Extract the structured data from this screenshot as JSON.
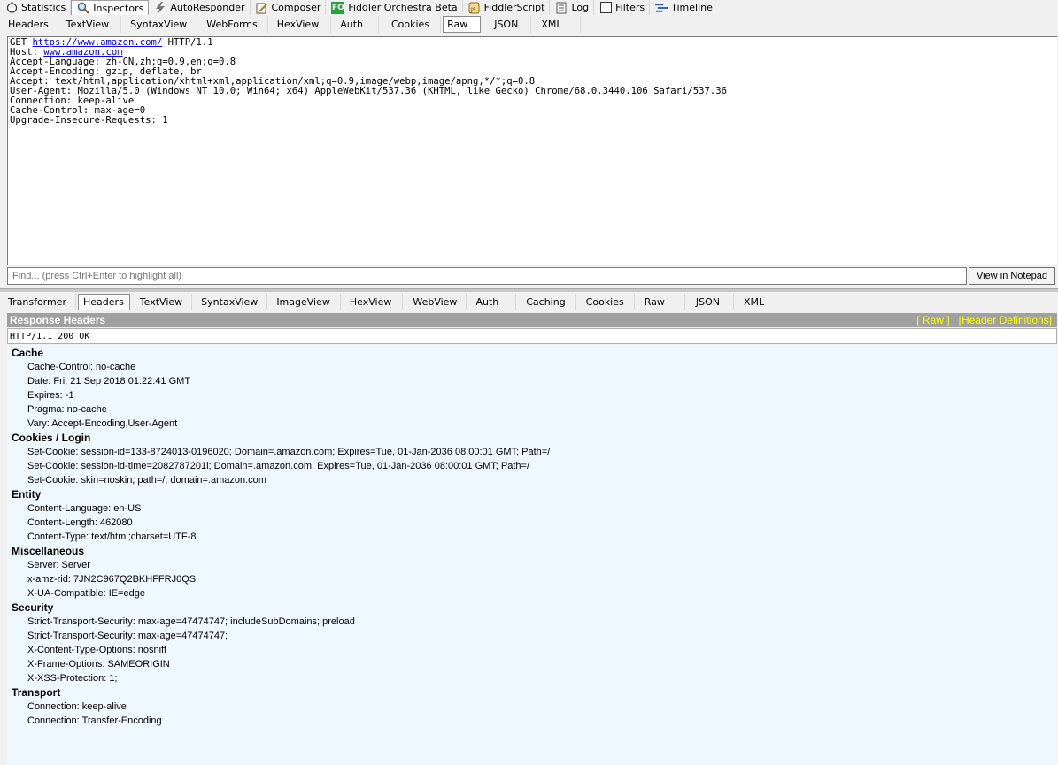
{
  "main_tabs": [
    {
      "label": "Statistics",
      "icon": "stopwatch-icon"
    },
    {
      "label": "Inspectors",
      "icon": "magnifier-icon"
    },
    {
      "label": "AutoResponder",
      "icon": "lightning-icon"
    },
    {
      "label": "Composer",
      "icon": "pencil-icon"
    },
    {
      "label": "Fiddler Orchestra Beta",
      "icon": "fo-icon"
    },
    {
      "label": "FiddlerScript",
      "icon": "script-icon"
    },
    {
      "label": "Log",
      "icon": "log-icon"
    },
    {
      "label": "Filters",
      "icon": "checkbox-icon"
    },
    {
      "label": "Timeline",
      "icon": "timeline-icon"
    }
  ],
  "fo_badge": "FO",
  "request_tabs": [
    "Headers",
    "TextView",
    "SyntaxView",
    "WebForms",
    "HexView",
    "Auth",
    "Cookies",
    "Raw",
    "JSON",
    "XML"
  ],
  "request_raw": {
    "method": "GET",
    "url": "https://www.amazon.com/",
    "protocol": "HTTP/1.1",
    "host_label": "Host:",
    "host": "www.amazon.com",
    "lines": [
      "Accept-Language: zh-CN,zh;q=0.9,en;q=0.8",
      "Accept-Encoding: gzip, deflate, br",
      "Accept: text/html,application/xhtml+xml,application/xml;q=0.9,image/webp,image/apng,*/*;q=0.8",
      "User-Agent: Mozilla/5.0 (Windows NT 10.0; Win64; x64) AppleWebKit/537.36 (KHTML, like Gecko) Chrome/68.0.3440.106 Safari/537.36",
      "Connection: keep-alive",
      "Cache-Control: max-age=0",
      "Upgrade-Insecure-Requests: 1"
    ]
  },
  "find": {
    "placeholder": "Find... (press Ctrl+Enter to highlight all)"
  },
  "view_in_notepad": "View in Notepad",
  "response_tabs": [
    "Transformer",
    "Headers",
    "TextView",
    "SyntaxView",
    "ImageView",
    "HexView",
    "WebView",
    "Auth",
    "Caching",
    "Cookies",
    "Raw",
    "JSON",
    "XML"
  ],
  "response": {
    "title": "Response Headers",
    "raw_link": "[ Raw ]",
    "defs_link": "[Header Definitions]",
    "status_line": "HTTP/1.1 200 OK",
    "groups": [
      {
        "name": "Cache",
        "headers": [
          "Cache-Control: no-cache",
          "Date: Fri, 21 Sep 2018 01:22:41 GMT",
          "Expires: -1",
          "Pragma: no-cache",
          "Vary: Accept-Encoding,User-Agent"
        ]
      },
      {
        "name": "Cookies / Login",
        "headers": [
          "Set-Cookie: session-id=133-8724013-0196020; Domain=.amazon.com; Expires=Tue, 01-Jan-2036 08:00:01 GMT; Path=/",
          "Set-Cookie: session-id-time=2082787201l; Domain=.amazon.com; Expires=Tue, 01-Jan-2036 08:00:01 GMT; Path=/",
          "Set-Cookie: skin=noskin; path=/; domain=.amazon.com"
        ]
      },
      {
        "name": "Entity",
        "headers": [
          "Content-Language: en-US",
          "Content-Length: 462080",
          "Content-Type: text/html;charset=UTF-8"
        ]
      },
      {
        "name": "Miscellaneous",
        "headers": [
          "Server: Server",
          "x-amz-rid: 7JN2C967Q2BKHFFRJ0QS",
          "X-UA-Compatible: IE=edge"
        ]
      },
      {
        "name": "Security",
        "headers": [
          "Strict-Transport-Security: max-age=47474747; includeSubDomains; preload",
          "Strict-Transport-Security: max-age=47474747;",
          "X-Content-Type-Options: nosniff",
          "X-Frame-Options: SAMEORIGIN",
          "X-XSS-Protection: 1;"
        ]
      },
      {
        "name": "Transport",
        "headers": [
          "Connection: keep-alive",
          "Connection: Transfer-Encoding"
        ]
      }
    ]
  },
  "colors": {
    "accent_link": "#0000ee",
    "header_bar": "#a0a0a0",
    "header_links": "#ffff00",
    "tree_bg": "#f0f8ff"
  }
}
